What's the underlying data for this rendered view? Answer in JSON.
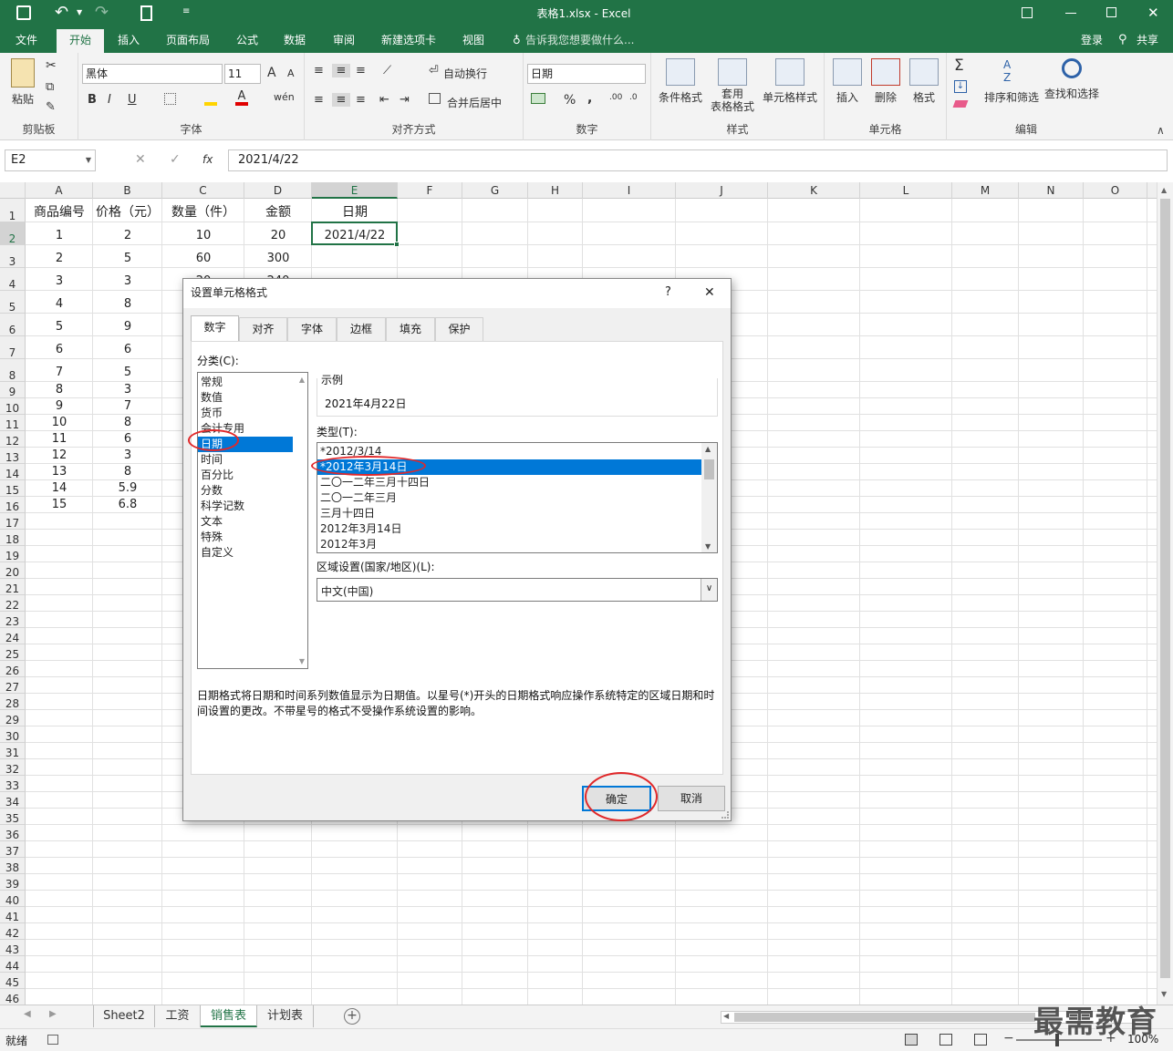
{
  "title": {
    "file": "表格1.xlsx",
    "sep": " - ",
    "app": "Excel"
  },
  "qat": {
    "save_icon": "save-icon",
    "undo_icon": "undo-icon",
    "redo_icon": "redo-icon",
    "new_icon": "new-file-icon"
  },
  "menu": {
    "tabs": [
      "文件",
      "开始",
      "插入",
      "页面布局",
      "公式",
      "数据",
      "审阅",
      "新建选项卡",
      "视图"
    ],
    "tellme": "告诉我您想要做什么...",
    "login": "登录",
    "share": "共享"
  },
  "ribbon": {
    "clipboard": {
      "paste": "粘贴",
      "label": "剪贴板"
    },
    "font": {
      "name": "黑体",
      "size": "11",
      "label": "字体",
      "bold": "B",
      "italic": "I",
      "underline": "U",
      "grow": "A",
      "shrink": "A"
    },
    "align": {
      "wrap": "自动换行",
      "merge": "合并后居中",
      "label": "对齐方式"
    },
    "number": {
      "format": "日期",
      "percent": "%",
      "comma": ",",
      "label": "数字"
    },
    "styles": {
      "cond": "条件格式",
      "table": "套用\n表格格式",
      "cell": "单元格样式",
      "label": "样式"
    },
    "cells": {
      "insert": "插入",
      "delete": "删除",
      "format": "格式",
      "label": "单元格"
    },
    "edit": {
      "sort": "排序和筛选",
      "find": "查找和选择",
      "label": "编辑"
    }
  },
  "formula_bar": {
    "name_box": "E2",
    "fx": "fx",
    "value": "2021/4/22"
  },
  "columns": [
    "A",
    "B",
    "C",
    "D",
    "E",
    "F",
    "G",
    "H",
    "I",
    "J",
    "K",
    "L",
    "M",
    "N",
    "O"
  ],
  "rows": [
    "1",
    "2",
    "3",
    "4",
    "5",
    "6",
    "7",
    "8",
    "9",
    "10",
    "11",
    "12",
    "13",
    "14",
    "15",
    "16",
    "17",
    "18",
    "19",
    "20",
    "21",
    "22",
    "23",
    "24",
    "25",
    "26",
    "27",
    "28",
    "29",
    "30",
    "31",
    "32",
    "33",
    "34",
    "35",
    "36",
    "37",
    "38",
    "39",
    "40",
    "41",
    "42",
    "43",
    "44",
    "45",
    "46"
  ],
  "cells": {
    "headers": [
      "商品编号",
      "价格（元）",
      "数量（件）",
      "金额",
      "日期"
    ],
    "data": [
      [
        "1",
        "2",
        "10",
        "20",
        "2021/4/22"
      ],
      [
        "2",
        "5",
        "60",
        "300",
        ""
      ],
      [
        "3",
        "3",
        "",
        "",
        ""
      ],
      [
        "4",
        "8",
        "",
        "",
        ""
      ],
      [
        "5",
        "9",
        "",
        "",
        ""
      ],
      [
        "6",
        "6",
        "",
        "",
        ""
      ],
      [
        "7",
        "5",
        "",
        "",
        ""
      ],
      [
        "8",
        "3",
        "",
        "",
        ""
      ],
      [
        "9",
        "7",
        "",
        "",
        ""
      ],
      [
        "10",
        "8",
        "",
        "",
        ""
      ],
      [
        "11",
        "6",
        "",
        "",
        ""
      ],
      [
        "12",
        "3",
        "",
        "",
        ""
      ],
      [
        "13",
        "8",
        "",
        "",
        ""
      ],
      [
        "14",
        "5.9",
        "",
        "",
        ""
      ],
      [
        "15",
        "6.8",
        "",
        "",
        ""
      ]
    ],
    "partial_c4": "20",
    "partial_d4": "240"
  },
  "dialog": {
    "title": "设置单元格格式",
    "help": "?",
    "close": "✕",
    "tabs": [
      "数字",
      "对齐",
      "字体",
      "边框",
      "填充",
      "保护"
    ],
    "category_label": "分类(C):",
    "categories": [
      "常规",
      "数值",
      "货币",
      "会计专用",
      "日期",
      "时间",
      "百分比",
      "分数",
      "科学记数",
      "文本",
      "特殊",
      "自定义"
    ],
    "selected_category": "日期",
    "sample_label": "示例",
    "sample_value": "2021年4月22日",
    "type_label": "类型(T):",
    "types": [
      "*2012/3/14",
      "*2012年3月14日",
      "二〇一二年三月十四日",
      "二〇一二年三月",
      "三月十四日",
      "2012年3月14日",
      "2012年3月"
    ],
    "selected_type": "*2012年3月14日",
    "locale_label": "区域设置(国家/地区)(L):",
    "locale_value": "中文(中国)",
    "description": "日期格式将日期和时间系列数值显示为日期值。以星号(*)开头的日期格式响应操作系统特定的区域日期和时间设置的更改。不带星号的格式不受操作系统设置的影响。",
    "ok": "确定",
    "cancel": "取消"
  },
  "sheets": {
    "tabs": [
      "Sheet2",
      "工资",
      "销售表",
      "计划表"
    ],
    "active": "销售表",
    "add": "+"
  },
  "status": {
    "ready": "就绪",
    "zoom": "100%"
  },
  "watermark": "最需教育",
  "colors": {
    "excel_green": "#217346",
    "selection_blue": "#0078d7",
    "annotation_red": "#e0282a"
  }
}
